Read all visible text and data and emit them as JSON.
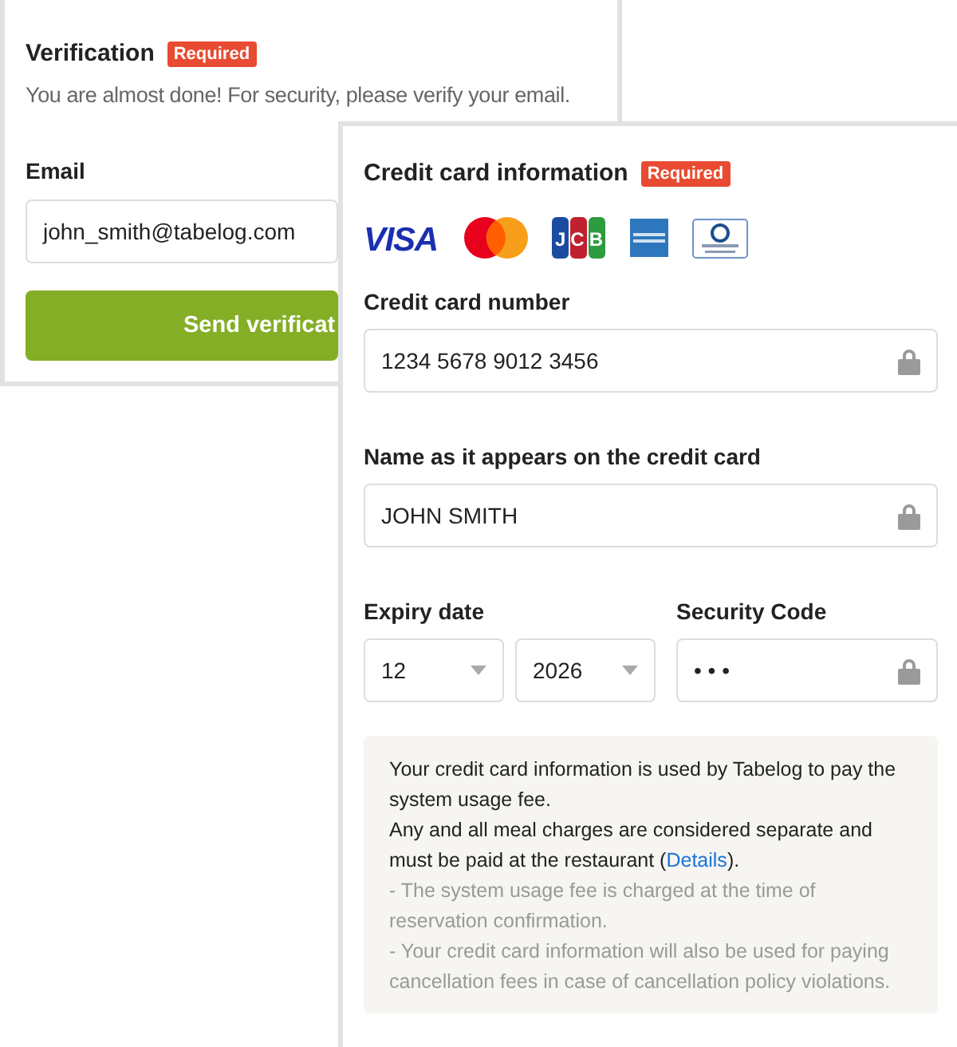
{
  "verification": {
    "title": "Verification",
    "badge": "Required",
    "description": "You are almost done! For security, please verify your email.",
    "email_label": "Email",
    "email_value": "john_smith@tabelog.com",
    "button": "Send verificat"
  },
  "credit_card": {
    "title": "Credit card information",
    "badge": "Required",
    "brands": [
      {
        "kind": "visa",
        "label": "VISA"
      },
      {
        "kind": "mastercard"
      },
      {
        "kind": "jcb",
        "label": "JCB"
      },
      {
        "kind": "amex"
      },
      {
        "kind": "diners"
      }
    ],
    "number_label": "Credit card number",
    "number_value": "1234 5678 9012 3456",
    "name_label": "Name as it appears on the credit card",
    "name_value": "JOHN SMITH",
    "expiry_label": "Expiry date",
    "month": "12",
    "year": "2026",
    "security_label": "Security Code",
    "security_value": "• • •",
    "note": {
      "main": [
        "Your credit card information is used by Tabelog to pay the system usage fee.",
        "Any and all meal charges are considered separate and must be paid at the restaurant ("
      ],
      "link": "Details",
      "after_link": ").",
      "minor": [
        "- The system usage fee is charged at the time of reservation confirmation.",
        "- Your credit card information will also be used for paying cancellation fees in case of cancellation policy violations."
      ]
    }
  }
}
